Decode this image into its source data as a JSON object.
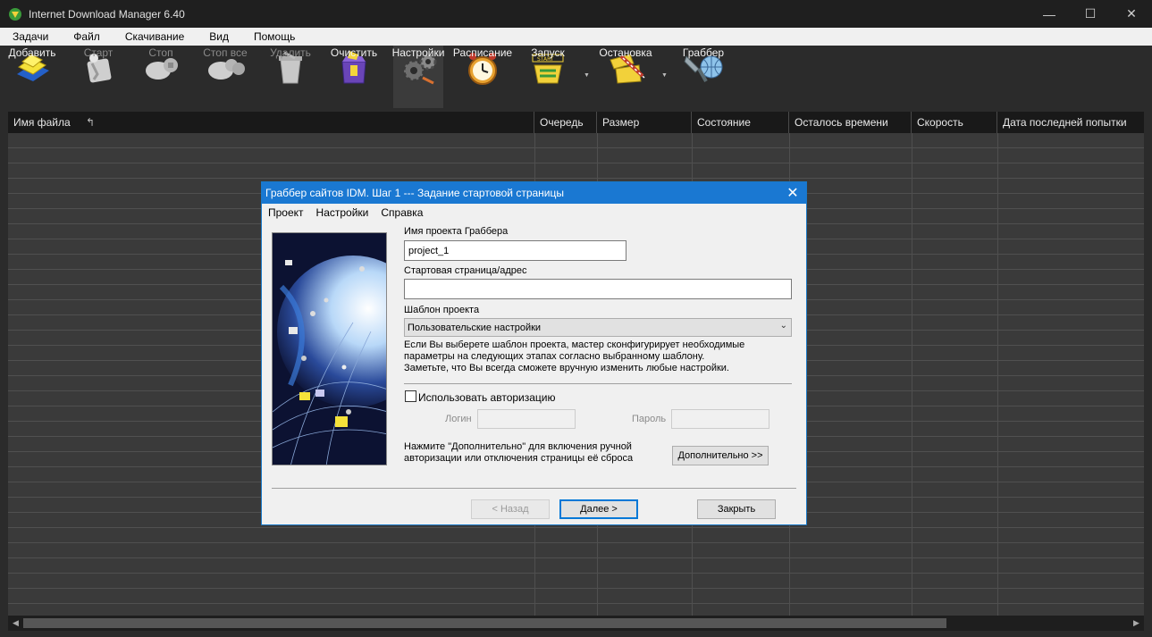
{
  "window": {
    "title": "Internet Download Manager 6.40"
  },
  "menu": [
    "Задачи",
    "Файл",
    "Скачивание",
    "Вид",
    "Помощь"
  ],
  "toolbar": [
    {
      "label": "Добавить",
      "icon": "add-icon",
      "enabled": true
    },
    {
      "label": "Старт",
      "icon": "start-icon",
      "enabled": false
    },
    {
      "label": "Стоп",
      "icon": "stop-icon",
      "enabled": false
    },
    {
      "label": "Стоп все",
      "icon": "stop-all-icon",
      "enabled": false
    },
    {
      "label": "Удалить",
      "icon": "delete-icon",
      "enabled": false
    },
    {
      "label": "Очистить",
      "icon": "clean-icon",
      "enabled": true
    },
    {
      "label": "Настройки",
      "icon": "settings-icon",
      "enabled": true
    },
    {
      "label": "Расписание",
      "icon": "scheduler-icon",
      "enabled": true
    },
    {
      "label": "Запуск",
      "icon": "start-queue-icon",
      "enabled": true
    },
    {
      "label": "Остановка",
      "icon": "stop-queue-icon",
      "enabled": true
    },
    {
      "label": "Граббер",
      "icon": "grabber-icon",
      "enabled": true
    }
  ],
  "table": {
    "columns": [
      "Имя файла",
      "Очередь",
      "Размер",
      "Состояние",
      "Осталось времени",
      "Скорость",
      "Дата последней попытки"
    ],
    "sort_icon": "sort-arrow-icon"
  },
  "dialog": {
    "title": "Граббер сайтов IDM. Шаг 1 --- Задание стартовой страницы",
    "menu": [
      "Проект",
      "Настройки",
      "Справка"
    ],
    "project_name_label": "Имя проекта Граббера",
    "project_name_value": "project_1",
    "start_page_label": "Стартовая страница/адрес",
    "start_page_value": "",
    "template_label": "Шаблон проекта",
    "template_value": "Пользовательские настройки",
    "template_help": [
      "Если Вы выберете шаблон проекта, мастер сконфигурирует необходимые",
      "параметры на следующих этапах согласно выбранному шаблону.",
      "Заметьте, что Вы всегда сможете вручную изменить любые настройки."
    ],
    "use_auth_label": "Использовать авторизацию",
    "use_auth_checked": false,
    "login_label": "Логин",
    "password_label": "Пароль",
    "advanced_help": [
      "Нажмите \"Дополнительно\" для включения ручной",
      "авторизации или отключения страницы её сброса"
    ],
    "advanced_button": "Дополнительно >>",
    "back_button": "< Назад",
    "next_button": "Далее >",
    "close_button": "Закрыть"
  }
}
